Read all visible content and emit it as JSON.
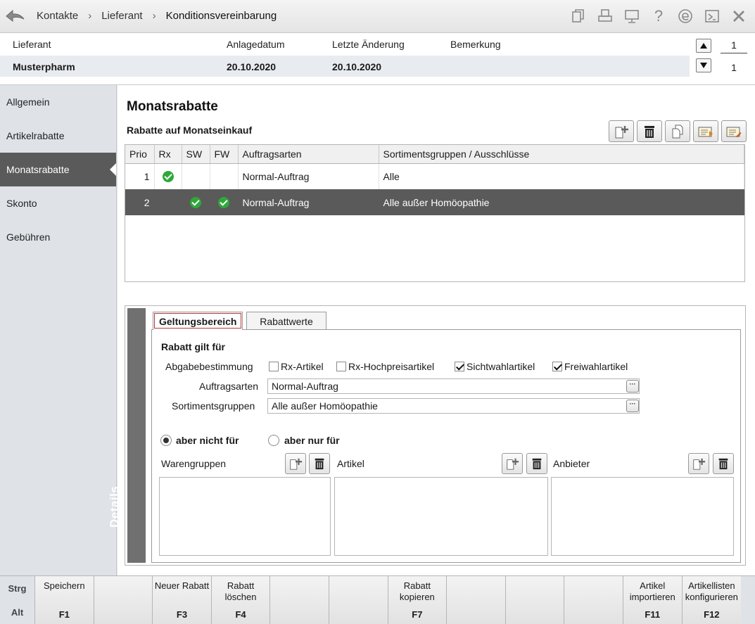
{
  "breadcrumb": [
    "Kontakte",
    "Lieferant",
    "Konditionsvereinbarung"
  ],
  "toolbar_icons": [
    "copy-icon",
    "print-icon",
    "monitor-icon",
    "help-icon",
    "info-e-icon",
    "window-icon",
    "close-icon"
  ],
  "help_glyph": "?",
  "header": {
    "labels": {
      "lieferant": "Lieferant",
      "anlagedatum": "Anlagedatum",
      "letzte_aenderung": "Letzte Änderung",
      "bemerkung": "Bemerkung"
    },
    "values": {
      "lieferant": "Musterpharm",
      "anlagedatum": "20.10.2020",
      "letzte_aenderung": "20.10.2020",
      "bemerkung": ""
    },
    "page_top": "1",
    "page_bottom": "1"
  },
  "sidebar": {
    "items": [
      {
        "label": "Allgemein",
        "active": false
      },
      {
        "label": "Artikelrabatte",
        "active": false
      },
      {
        "label": "Monatsrabatte",
        "active": true
      },
      {
        "label": "Skonto",
        "active": false
      },
      {
        "label": "Gebühren",
        "active": false
      }
    ]
  },
  "main": {
    "title": "Monatsrabatte",
    "subtitle": "Rabatte auf Monatseinkauf",
    "table": {
      "columns": [
        "Prio",
        "Rx",
        "SW",
        "FW",
        "Auftragsarten",
        "Sortimentsgruppen / Ausschlüsse"
      ],
      "rows": [
        {
          "prio": "1",
          "rx": true,
          "sw": false,
          "fw": false,
          "auftragsarten": "Normal-Auftrag",
          "sortiment": "Alle",
          "selected": false
        },
        {
          "prio": "2",
          "rx": false,
          "sw": true,
          "fw": true,
          "auftragsarten": "Normal-Auftrag",
          "sortiment": "Alle außer Homöopathie",
          "selected": true
        }
      ]
    }
  },
  "details": {
    "strip_label": "Details",
    "tabs": [
      "Geltungsbereich",
      "Rabattwerte"
    ],
    "section_title": "Rabatt gilt für",
    "abgabe_label": "Abgabebestimmung",
    "checkboxes": [
      {
        "label": "Rx-Artikel",
        "checked": false
      },
      {
        "label": "Rx-Hochpreisartikel",
        "checked": false
      },
      {
        "label": "Sichtwahlartikel",
        "checked": true
      },
      {
        "label": "Freiwahlartikel",
        "checked": true
      }
    ],
    "auftragsarten_label": "Auftragsarten",
    "auftragsarten_value": "Normal-Auftrag",
    "sortiment_label": "Sortimentsgruppen",
    "sortiment_value": "Alle außer Homöopathie",
    "ellipsis": "···",
    "radio_nicht": "aber nicht für",
    "radio_nur": "aber nur für",
    "warengruppen": "Warengruppen",
    "artikel": "Artikel",
    "anbieter": "Anbieter"
  },
  "fbar": {
    "mod_strg": "Strg",
    "mod_alt": "Alt",
    "keys": [
      {
        "label": "Speichern",
        "key": "F1"
      },
      {
        "label": "",
        "key": ""
      },
      {
        "label": "Neuer Rabatt",
        "key": "F3"
      },
      {
        "label": "Rabatt löschen",
        "key": "F4"
      },
      {
        "label": "",
        "key": ""
      },
      {
        "label": "",
        "key": ""
      },
      {
        "label": "Rabatt kopieren",
        "key": "F7"
      },
      {
        "label": "",
        "key": ""
      },
      {
        "label": "",
        "key": ""
      },
      {
        "label": "",
        "key": ""
      },
      {
        "label": "Artikel importieren",
        "key": "F11"
      },
      {
        "label": "Artikellisten konfigurieren",
        "key": "F12"
      }
    ]
  }
}
